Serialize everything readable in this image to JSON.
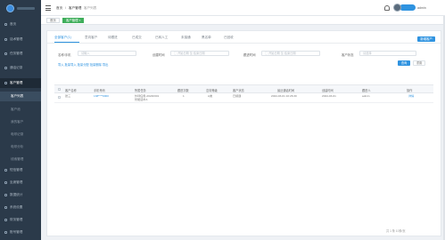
{
  "sidebar": {
    "items": [
      {
        "label": "首页"
      },
      {
        "label": "话术管理"
      },
      {
        "label": "任务管理"
      },
      {
        "label": "通话记录"
      },
      {
        "label": "客户管理"
      },
      {
        "label": "客户列表"
      },
      {
        "label": "客户池"
      },
      {
        "label": "我的客户"
      },
      {
        "label": "电呼记录"
      },
      {
        "label": "电呼分析"
      },
      {
        "label": "线索管理"
      },
      {
        "label": "短信管理"
      },
      {
        "label": "坐席管理"
      },
      {
        "label": "数据统计"
      },
      {
        "label": "系统设置"
      },
      {
        "label": "财务管理"
      },
      {
        "label": "账号管理"
      }
    ]
  },
  "topbar": {
    "breadcrumb_home": "首页",
    "breadcrumb_sep": "/",
    "breadcrumb_current": "客户管理",
    "breadcrumb_sub": "客户列表",
    "user_name": "admin"
  },
  "tags": [
    {
      "label": "首页"
    },
    {
      "label": "客户管理 ×"
    }
  ],
  "tabs": [
    {
      "label": "全部客户(1)"
    },
    {
      "label": "意向客户"
    },
    {
      "label": "待跟进"
    },
    {
      "label": "已成交"
    },
    {
      "label": "已转人工"
    },
    {
      "label": "未接通"
    },
    {
      "label": "黑名单"
    },
    {
      "label": "已回收"
    }
  ],
  "actions": {
    "add_button": "新增客户"
  },
  "filters": {
    "name_label": "名称/手机",
    "name_placeholder": "请输入",
    "create_time_label": "创建时间",
    "start_placeholder": "开始日期",
    "range_sep": "至",
    "end_placeholder": "结束日期",
    "follow_time_label": "跟进时间",
    "follow_start": "开始日期",
    "follow_end": "结束日期",
    "status_label": "客户状态",
    "status_placeholder": "请选择",
    "quick_links": "导入  批量导入  批量分配  批量删除  导出",
    "search_button": "查询",
    "reset_button": "重置"
  },
  "table": {
    "headers": [
      "客户名称",
      "手机号码",
      "所属任务",
      "跟进次数",
      "意向等级",
      "客户状态",
      "最近通话时间",
      "创建时间",
      "跟进人",
      "操作"
    ],
    "rows": [
      {
        "name": "张三",
        "phone": "138****0000",
        "task": "外呼任务-20240301",
        "task_line2": "智能话术A",
        "follow_count": "1",
        "intent": "A类",
        "status": "已接通",
        "last_call": "2024-03-01 10:26:30",
        "created": "2024-03-01",
        "owner": "admin",
        "op": "详情"
      }
    ]
  },
  "pager": {
    "text": "共 1 条  10条/页"
  }
}
